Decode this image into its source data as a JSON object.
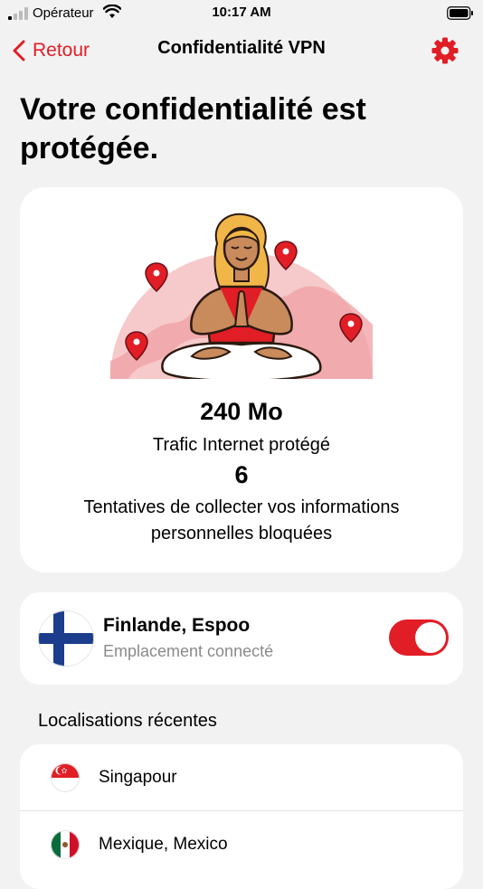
{
  "status_bar": {
    "carrier": "Opérateur",
    "time": "10:17 AM"
  },
  "nav": {
    "back_label": "Retour",
    "title": "Confidentialité VPN"
  },
  "page_title": "Votre confidentialité est protégée.",
  "stats": {
    "traffic_value": "240 Mo",
    "traffic_label": "Trafic Internet protégé",
    "blocked_value": "6",
    "blocked_label": "Tentatives de collecter vos informations personnelles bloquées"
  },
  "connected_location": {
    "name": "Finlande, Espoo",
    "status": "Emplacement connecté",
    "flag": "finland-flag",
    "vpn_enabled": true
  },
  "recent": {
    "header": "Localisations récentes",
    "items": [
      {
        "label": "Singapour",
        "flag": "singapore-flag"
      },
      {
        "label": "Mexique, Mexico",
        "flag": "mexico-flag"
      }
    ]
  },
  "colors": {
    "accent": "#e11d26",
    "background": "#f2f2f2",
    "card": "#ffffff",
    "muted_text": "#8a8a8a"
  }
}
